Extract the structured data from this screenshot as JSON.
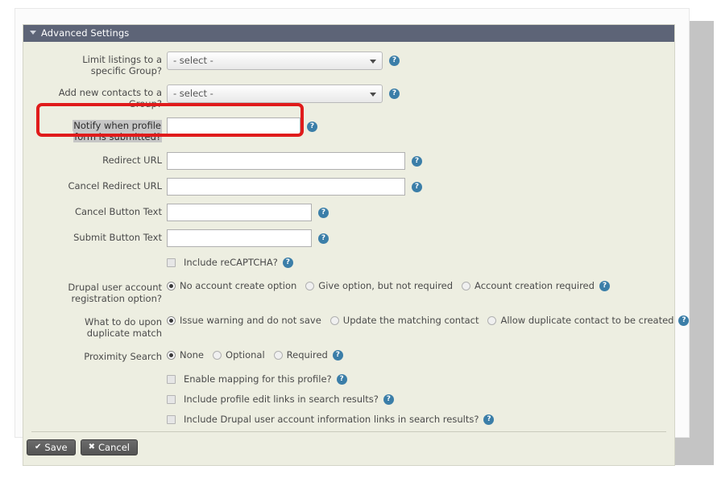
{
  "fieldset": {
    "legend": "Advanced Settings",
    "collapse_icon": "triangle-down-icon"
  },
  "fields": {
    "limit_listings": {
      "label_line1": "Limit listings to a",
      "label_line2": "specific Group?",
      "value": "- select -",
      "help": "?"
    },
    "add_contacts_group": {
      "label_line1": "Add new contacts to a",
      "label_line2": "Group?",
      "value": "- select -",
      "help": "?"
    },
    "notify_profile": {
      "label_line1": "Notify when profile",
      "label_line2": "form is submitted?",
      "value": "",
      "help": "?"
    },
    "redirect_url": {
      "label": "Redirect URL",
      "value": "",
      "help": "?"
    },
    "cancel_redirect_url": {
      "label": "Cancel Redirect URL",
      "value": "",
      "help": "?"
    },
    "cancel_button_text": {
      "label": "Cancel Button Text",
      "value": "",
      "help": "?"
    },
    "submit_button_text": {
      "label": "Submit Button Text",
      "value": "",
      "help": "?"
    }
  },
  "checkboxes": [
    {
      "label": "Include reCAPTCHA?",
      "checked": false,
      "help": "?"
    },
    {
      "label": "Enable mapping for this profile?",
      "checked": false,
      "help": "?"
    },
    {
      "label": "Include profile edit links in search results?",
      "checked": false,
      "help": "?"
    },
    {
      "label": "Include Drupal user account information links in search results?",
      "checked": false,
      "help": "?"
    }
  ],
  "radio_groups": {
    "registration": {
      "label_line1": "Drupal user account",
      "label_line2": "registration option?",
      "help": "?",
      "options": [
        {
          "label": "No account create option",
          "selected": true
        },
        {
          "label": "Give option, but not required",
          "selected": false
        },
        {
          "label": "Account creation required",
          "selected": false
        }
      ]
    },
    "duplicate_match": {
      "label_line1": "What to do upon",
      "label_line2": "duplicate match",
      "help": "?",
      "options": [
        {
          "label": "Issue warning and do not save",
          "selected": true
        },
        {
          "label": "Update the matching contact",
          "selected": false
        },
        {
          "label": "Allow duplicate contact to be created",
          "selected": false
        }
      ]
    },
    "proximity_search": {
      "label_line1": "Proximity Search",
      "label_line2": "",
      "help": "?",
      "options": [
        {
          "label": "None",
          "selected": true
        },
        {
          "label": "Optional",
          "selected": false
        },
        {
          "label": "Required",
          "selected": false
        }
      ]
    }
  },
  "buttons": {
    "save": {
      "label": "Save",
      "icon": "check-icon",
      "glyph": "✔"
    },
    "cancel": {
      "label": "Cancel",
      "icon": "x-icon",
      "glyph": "✖"
    }
  },
  "annotation": {
    "color": "#e01b1b",
    "target": "notify-when-profile-form-is-submitted-row"
  }
}
